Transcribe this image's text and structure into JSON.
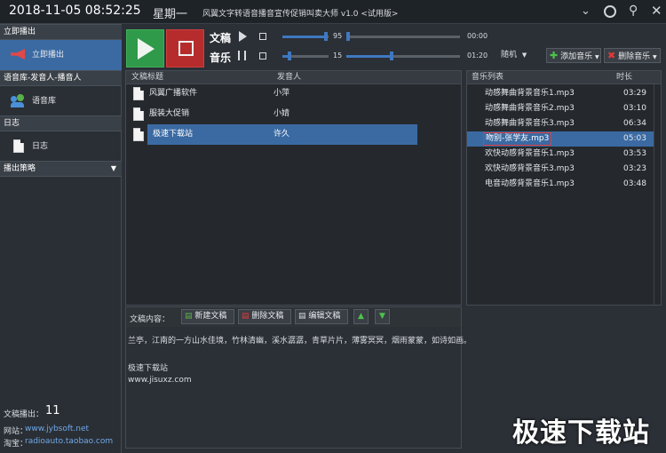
{
  "title": {
    "datetime": "2018-11-05 08:52:25",
    "weekday": "星期一",
    "app_title": "风翼文字转语音播音宣传促销叫卖大师 v1.0 <试用版>"
  },
  "controls": {
    "doc_label": "文稿",
    "doc_volume": "95",
    "doc_time": "00:00",
    "doc_volume_level": 0.95,
    "music_label": "音乐",
    "music_volume": "15",
    "music_time": "01:20",
    "music_volume_level": 0.15,
    "music_progress": 0.4,
    "random_label": "随机",
    "add_music": "添加音乐",
    "delete_music": "删除音乐"
  },
  "sidebar": {
    "immediate_header": "立即播出",
    "immediate_item": "立即播出",
    "voice_header": "语音库-发音人-播音人",
    "voice_item": "语音库",
    "log_header": "日志",
    "log_item": "日志",
    "strategy_header": "播出策略",
    "doc_count_label": "文稿播出：",
    "doc_count": "11",
    "website_label": "网站：",
    "website": "www.jybsoft.net",
    "taobao_label": "淘宝：",
    "taobao": "radioauto.taobao.com"
  },
  "docs": {
    "col_title": "文稿标题",
    "col_speaker": "发音人",
    "rows": [
      {
        "title": "风翼广播软件",
        "speaker": "小萍"
      },
      {
        "title": "服装大促销",
        "speaker": "小婧"
      },
      {
        "title": "极速下载站",
        "speaker": "许久"
      }
    ]
  },
  "music": {
    "col_name": "音乐列表",
    "col_duration": "时长",
    "rows": [
      {
        "name": "动感舞曲背景音乐1.mp3",
        "duration": "03:29"
      },
      {
        "name": "动感舞曲背景音乐2.mp3",
        "duration": "03:10"
      },
      {
        "name": "动感舞曲背景音乐3.mp3",
        "duration": "06:34"
      },
      {
        "name": "吻别-张学友.mp3",
        "duration": "05:03"
      },
      {
        "name": "欢快动感背景音乐1.mp3",
        "duration": "03:53"
      },
      {
        "name": "欢快动感背景音乐3.mp3",
        "duration": "03:23"
      },
      {
        "name": "电音动感背景音乐1.mp3",
        "duration": "03:48"
      }
    ]
  },
  "content": {
    "label": "文稿内容：",
    "new_doc": "新建文稿",
    "delete_doc": "删除文稿",
    "edit_doc": "编辑文稿",
    "line1": "兰亭，江南的一方山水佳境，竹林清幽，溪水潺潺，青草片片，薄雾冥冥，烟雨蒙蒙，如诗如画。",
    "line2": "极速下载站",
    "line3": "www.jisuxz.com"
  },
  "watermark": "极速下载站"
}
